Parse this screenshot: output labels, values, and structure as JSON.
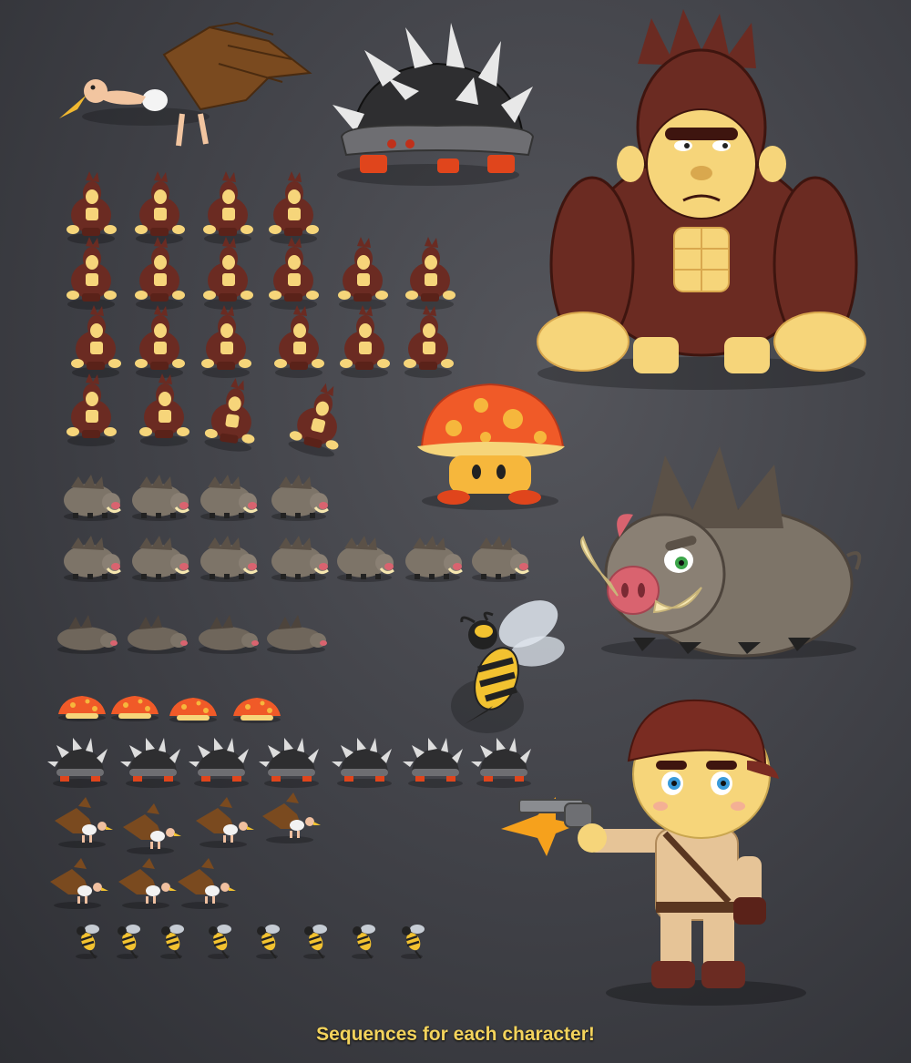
{
  "caption": "Sequences for each character!",
  "colors": {
    "background": "#3f4046",
    "caption": "#f3d35c",
    "gorilla_fur": "#6b2b22",
    "gorilla_skin": "#f6d57a",
    "boar_body": "#7d7468",
    "mushroom_cap": "#f05a28",
    "spiky_shell": "#2e2e30",
    "vulture_wing": "#7a4a1f",
    "bee_yellow": "#f2c230",
    "hero_hat": "#7a2c22"
  },
  "characters": [
    {
      "name": "vulture",
      "icon": "vulture-icon"
    },
    {
      "name": "spiky-shell",
      "icon": "spiky-shell-icon"
    },
    {
      "name": "gorilla",
      "icon": "gorilla-icon"
    },
    {
      "name": "mushroom",
      "icon": "mushroom-icon"
    },
    {
      "name": "boar",
      "icon": "boar-icon"
    },
    {
      "name": "bee",
      "icon": "bee-icon"
    },
    {
      "name": "explorer",
      "icon": "explorer-icon"
    }
  ]
}
